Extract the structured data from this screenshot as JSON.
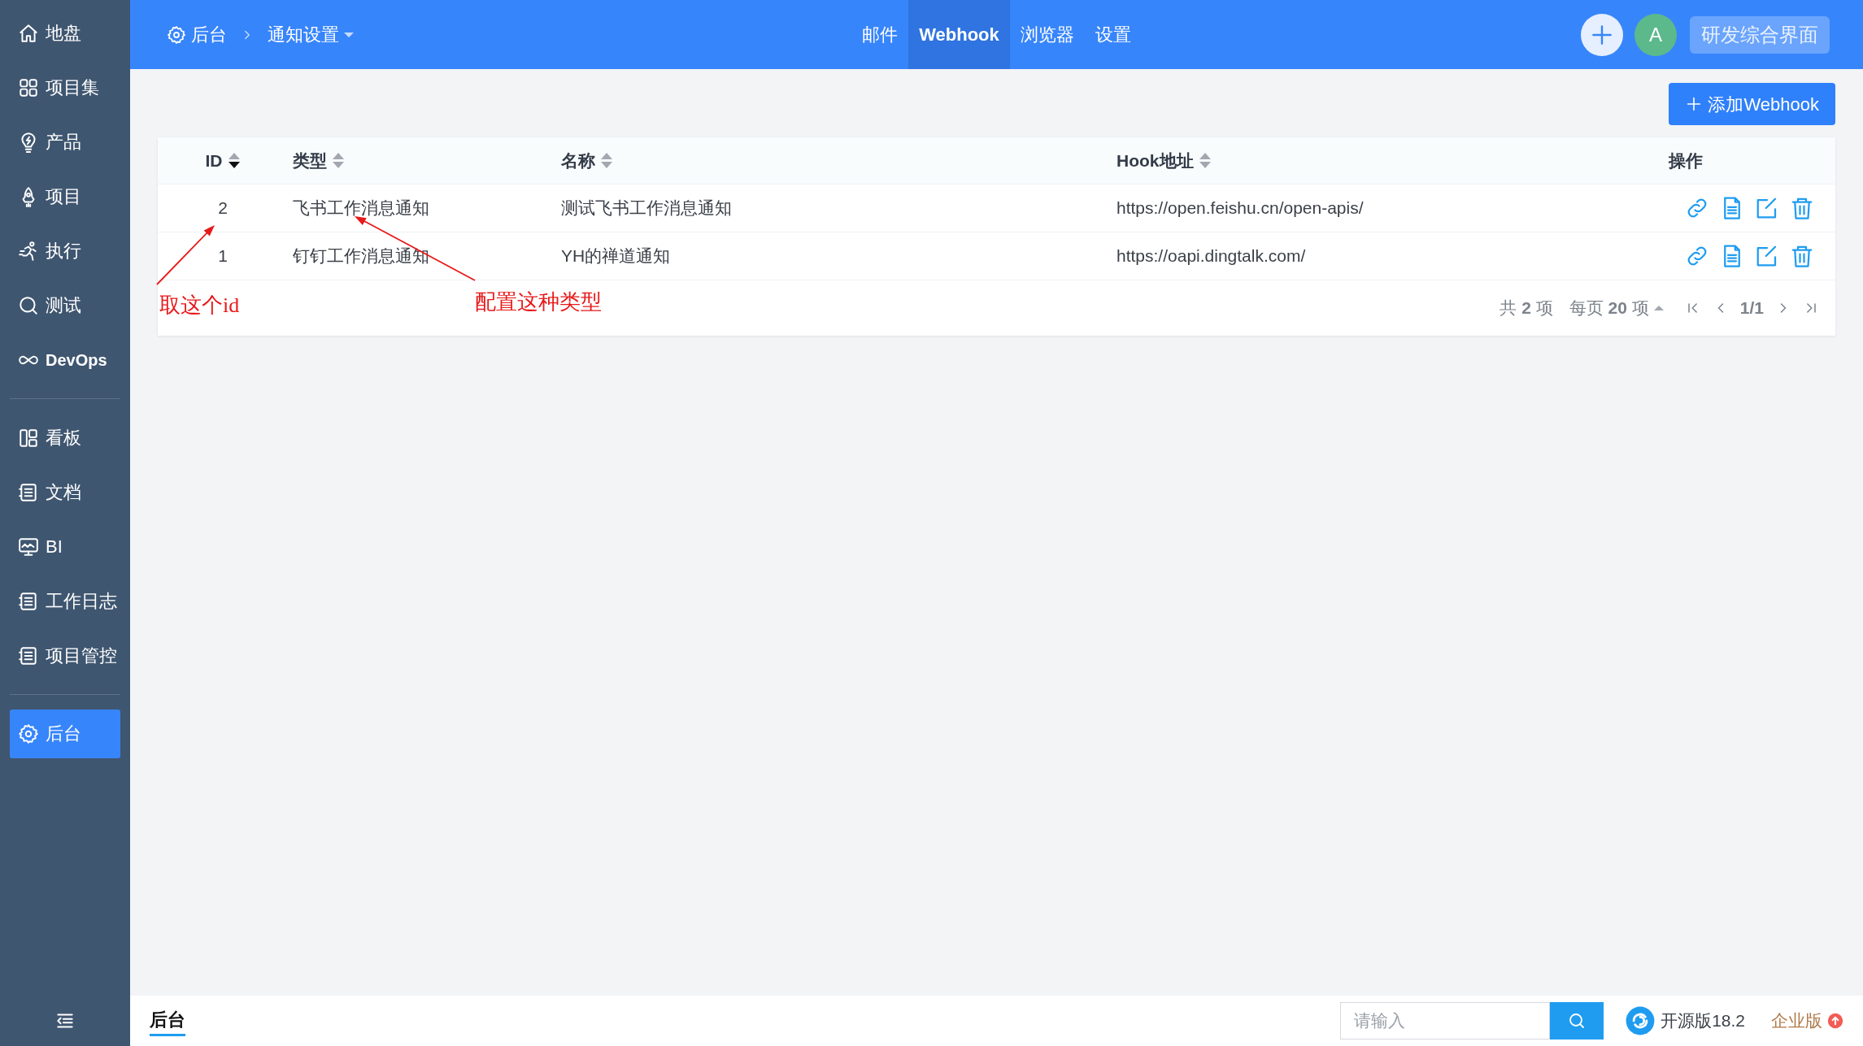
{
  "sidebar": {
    "groups": [
      [
        {
          "label": "地盘",
          "selected": false
        },
        {
          "label": "项目集",
          "selected": false
        },
        {
          "label": "产品",
          "selected": false
        },
        {
          "label": "项目",
          "selected": false
        },
        {
          "label": "执行",
          "selected": false
        },
        {
          "label": "测试",
          "selected": false
        },
        {
          "label": "DevOps",
          "selected": false
        }
      ],
      [
        {
          "label": "看板",
          "selected": false
        },
        {
          "label": "文档",
          "selected": false
        },
        {
          "label": "BI",
          "selected": false
        },
        {
          "label": "工作日志",
          "selected": false
        },
        {
          "label": "项目管控",
          "selected": false
        }
      ],
      [
        {
          "label": "后台",
          "selected": true
        }
      ]
    ]
  },
  "topbar": {
    "breadcrumb": {
      "root": "后台",
      "current": "通知设置"
    },
    "tabs": [
      {
        "label": "邮件",
        "selected": false
      },
      {
        "label": "Webhook",
        "selected": true
      },
      {
        "label": "浏览器",
        "selected": false
      },
      {
        "label": "设置",
        "selected": false
      }
    ],
    "avatar": "A",
    "switch_button": "研发综合界面"
  },
  "add_button": "添加Webhook",
  "table": {
    "columns": [
      {
        "label": "ID",
        "sortable": true,
        "sorted_desc": true
      },
      {
        "label": "类型",
        "sortable": true,
        "sorted_desc": false
      },
      {
        "label": "名称",
        "sortable": true,
        "sorted_desc": false
      },
      {
        "label": "Hook地址",
        "sortable": true,
        "sorted_desc": false
      },
      {
        "label": "操作",
        "sortable": false
      }
    ],
    "rows": [
      {
        "id": "2",
        "type": "飞书工作消息通知",
        "name": "测试飞书工作消息通知",
        "url": "https://open.feishu.cn/open-apis/"
      },
      {
        "id": "1",
        "type": "钉钉工作消息通知",
        "name": "YH的禅道通知",
        "url": "https://oapi.dingtalk.com/"
      }
    ],
    "pagination": {
      "total": "共 **2** 项",
      "per_page": "每页 **20** 项",
      "page": "1/1"
    }
  },
  "annotations": [
    {
      "text": "取这个id"
    },
    {
      "text": "配置这种类型"
    }
  ],
  "bottom_bar": {
    "tab": "后台",
    "search": {
      "placeholder": "请输入"
    },
    "version": "开源版18.2",
    "upgrade": "企业版"
  }
}
